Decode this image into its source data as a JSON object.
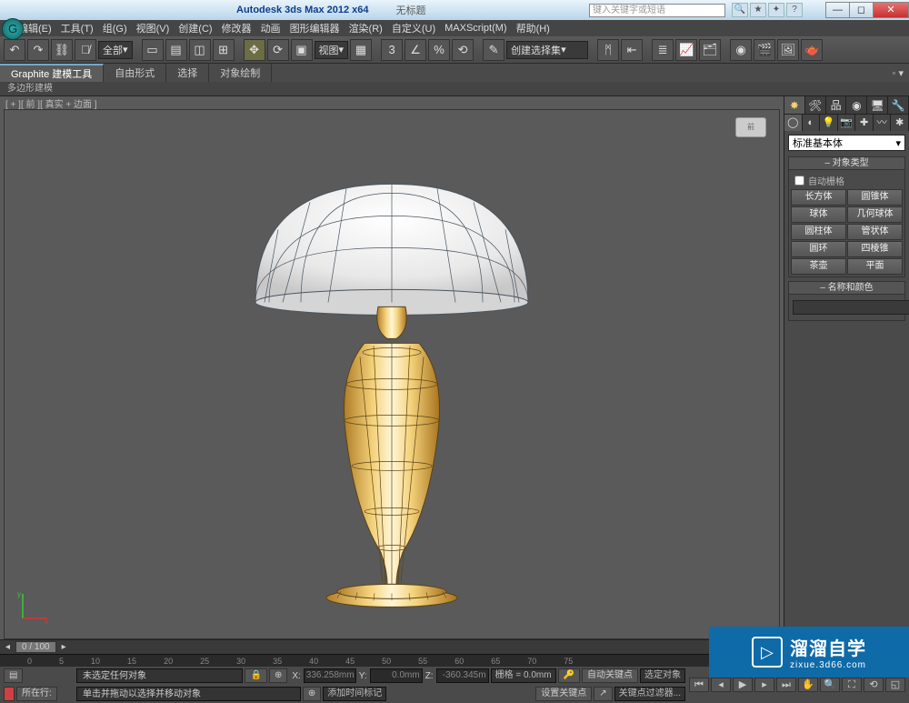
{
  "title": "Autodesk 3ds Max  2012 x64",
  "doc": "无标题",
  "search_placeholder": "键入关键字或短语",
  "menu": [
    "编辑(E)",
    "工具(T)",
    "组(G)",
    "视图(V)",
    "创建(C)",
    "修改器",
    "动画",
    "图形编辑器",
    "渲染(R)",
    "自定义(U)",
    "MAXScript(M)",
    "帮助(H)"
  ],
  "toolbar": {
    "all": "全部",
    "view": "视图"
  },
  "ribbon": {
    "tabs": [
      "Graphite 建模工具",
      "自由形式",
      "选择",
      "对象绘制"
    ],
    "sub": "多边形建模"
  },
  "viewport_label": "[ + ][ 前 ][ 真实 + 边面 ]",
  "viewcube": "前",
  "cmd": {
    "combo": "标准基本体",
    "rollout_type": "对象类型",
    "autogrid": "自动栅格",
    "prims": [
      "长方体",
      "圆锥体",
      "球体",
      "几何球体",
      "圆柱体",
      "管状体",
      "圆环",
      "四棱锥",
      "茶壶",
      "平面"
    ],
    "rollout_name": "名称和颜色"
  },
  "time": {
    "range": "0 / 100",
    "marks": [
      "0",
      "5",
      "10",
      "15",
      "20",
      "25",
      "30",
      "35",
      "40",
      "45",
      "50",
      "55",
      "60",
      "65",
      "70",
      "75"
    ]
  },
  "status": {
    "loc": "所在行:",
    "sel": "未选定任何对象",
    "prompt": "单击并拖动以选择并移动对象",
    "x": "336.258mm",
    "y": "0.0mm",
    "z": "-360.345m",
    "grid": "栅格 = 0.0mm",
    "addtag": "添加时间标记",
    "autokey": "自动关键点",
    "selset": "选定对象",
    "setkey": "设置关键点",
    "keyfilter": "关键点过滤器..."
  },
  "selection_combo": "创建选择集",
  "watermark": {
    "big": "溜溜自学",
    "small": "zixue.3d66.com"
  }
}
